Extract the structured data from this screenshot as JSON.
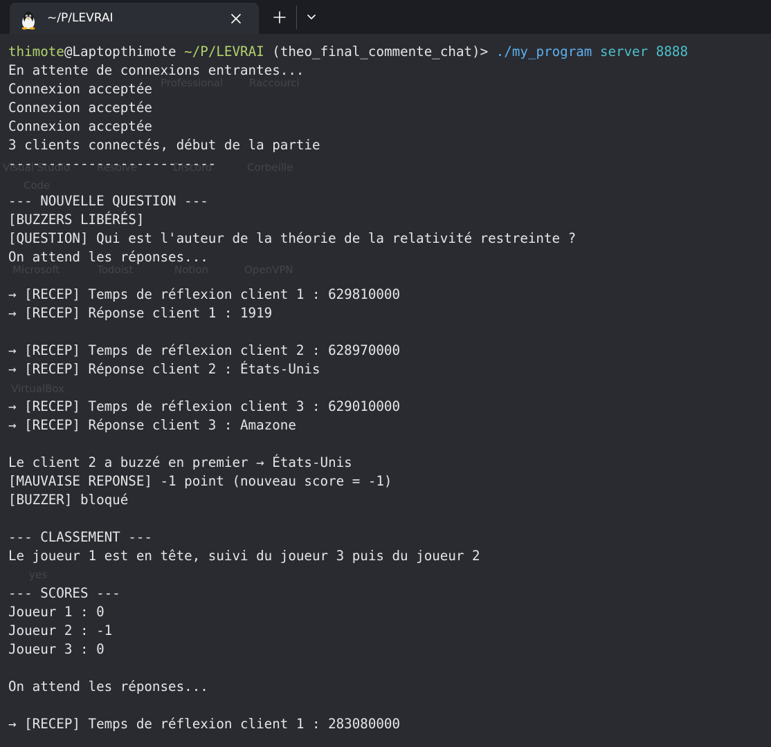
{
  "tab": {
    "title": "~/P/LEVRAI",
    "icon": "linux-penguin-icon",
    "close_icon": "close-icon",
    "new_tab_icon": "plus-icon",
    "dropdown_icon": "chevron-down-icon"
  },
  "colors": {
    "background": "#292b31",
    "tabbar": "#1b1d22",
    "tab_active": "#2b2e35",
    "text": "#e6e6e6",
    "prompt_green": "#b5d36b",
    "command_blue": "#5fb0ec",
    "argument_cyan": "#4fc0c9"
  },
  "prompt": {
    "user": "thimote",
    "host": "@Laptopthimote",
    "path": "~/P/LEVRAI",
    "branch": "(theo_final_commente_chat)>",
    "command": "./my_program",
    "args": "server 8888"
  },
  "output": [
    "En attente de connexions entrantes...",
    "Connexion acceptée",
    "Connexion acceptée",
    "Connexion acceptée",
    "3 clients connectés, début de la partie",
    "--------------------------",
    "",
    "--- NOUVELLE QUESTION ---",
    "[BUZZERS LIBÉRÉS]",
    "[QUESTION] Qui est l'auteur de la théorie de la relativité restreinte ?",
    "On attend les réponses...",
    "",
    "→ [RECEP] Temps de réflexion client 1 : 629810000",
    "→ [RECEP] Réponse client 1 : 1919",
    "",
    "→ [RECEP] Temps de réflexion client 2 : 628970000",
    "→ [RECEP] Réponse client 2 : États-Unis",
    "",
    "→ [RECEP] Temps de réflexion client 3 : 629010000",
    "→ [RECEP] Réponse client 3 : Amazone",
    "",
    "Le client 2 a buzzé en premier → États-Unis",
    "[MAUVAISE REPONSE] -1 point (nouveau score = -1)",
    "[BUZZER] bloqué",
    "",
    "--- CLASSEMENT ---",
    "Le joueur 1 est en tête, suivi du joueur 3 puis du joueur 2",
    "",
    "--- SCORES ---",
    "Joueur 1 : 0",
    "Joueur 2 : -1",
    "Joueur 3 : 0",
    "",
    "On attend les réponses...",
    "",
    "→ [RECEP] Temps de réflexion client 1 : 283080000"
  ],
  "desktop_ghosts": [
    "Professional",
    "Raccourci",
    "Visual Studio",
    "Resolve",
    "Discord",
    "Corbeille",
    "Code",
    "Microsoft",
    "Todoist",
    "Notion",
    "OpenVPN",
    "VirtualBox",
    "yes"
  ]
}
